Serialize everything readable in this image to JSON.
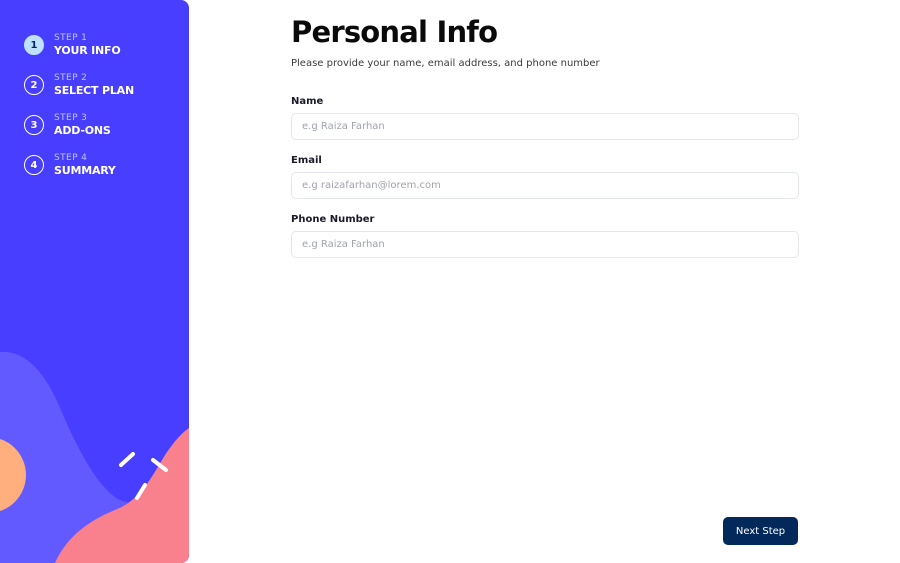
{
  "colors": {
    "sidebar_bg": "#483eff",
    "active_step_bg": "#bee2fd",
    "button_bg": "#022959",
    "wave_light": "#6259ff",
    "wave_pink": "#f9818e",
    "circle_orange": "#ffaf7e"
  },
  "sidebar": {
    "steps": [
      {
        "number": "1",
        "label": "STEP 1",
        "title": "YOUR INFO",
        "active": true
      },
      {
        "number": "2",
        "label": "STEP 2",
        "title": "SELECT PLAN",
        "active": false
      },
      {
        "number": "3",
        "label": "STEP 3",
        "title": "ADD-ONS",
        "active": false
      },
      {
        "number": "4",
        "label": "STEP 4",
        "title": "SUMMARY",
        "active": false
      }
    ]
  },
  "main": {
    "title": "Personal Info",
    "subtitle": "Please provide your name, email address, and phone number",
    "fields": {
      "name": {
        "label": "Name",
        "placeholder": "e.g Raiza Farhan",
        "value": ""
      },
      "email": {
        "label": "Email",
        "placeholder": "e.g raizafarhan@lorem.com",
        "value": ""
      },
      "phone": {
        "label": "Phone Number",
        "placeholder": "e.g Raiza Farhan",
        "value": ""
      }
    },
    "next_label": "Next Step"
  }
}
